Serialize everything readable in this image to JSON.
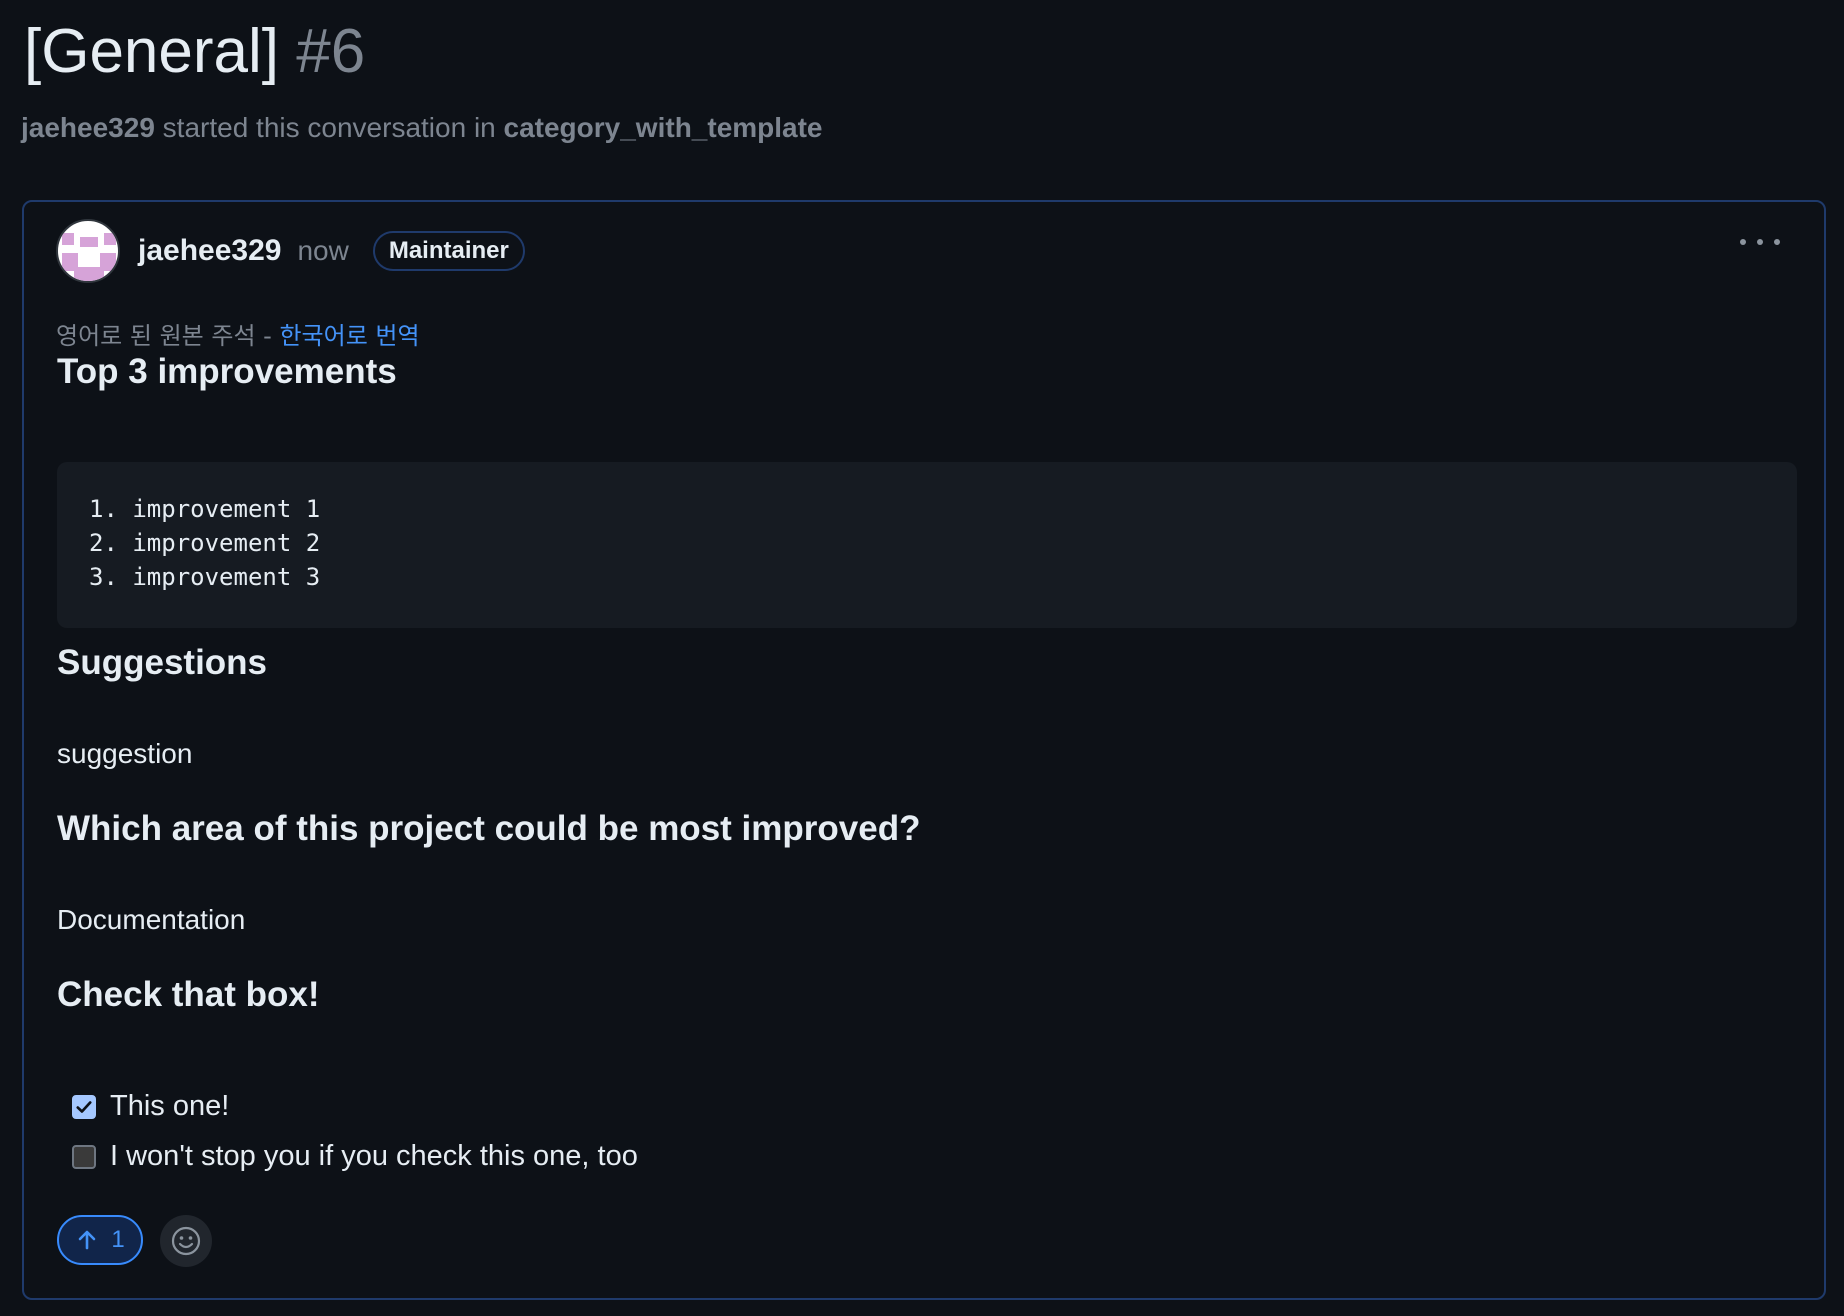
{
  "discussion": {
    "title": "[General]",
    "number": "#6",
    "meta": {
      "author": "jaehee329",
      "middle_text": "started this conversation in",
      "category": "category_with_template"
    }
  },
  "comment": {
    "author": "jaehee329",
    "time": "now",
    "badge": "Maintainer",
    "translation": {
      "original_text": "영어로 된 원본 주석 -",
      "link_text": "한국어로 번역"
    },
    "sections": {
      "improvements_heading": "Top 3 improvements",
      "improvements_code": "1. improvement 1\n2. improvement 2\n3. improvement 3",
      "suggestions_heading": "Suggestions",
      "suggestions_text": "suggestion",
      "area_heading": "Which area of this project could be most improved?",
      "area_text": "Documentation",
      "checkbox_heading": "Check that box!"
    },
    "tasks": [
      {
        "label": "This one!",
        "checked": true
      },
      {
        "label": "I won't stop you if you check this one, too",
        "checked": false
      }
    ],
    "upvote_count": "1"
  },
  "icons": {
    "more": "kebab-horizontal-icon",
    "upvote": "arrow-up-icon",
    "react": "smiley-icon",
    "check": "check-icon"
  },
  "colors": {
    "background": "#0d1117",
    "border_accent": "#1f3a6b",
    "link": "#4493f8",
    "muted": "#7d8590",
    "checkbox_checked": "#a5c8ff"
  }
}
